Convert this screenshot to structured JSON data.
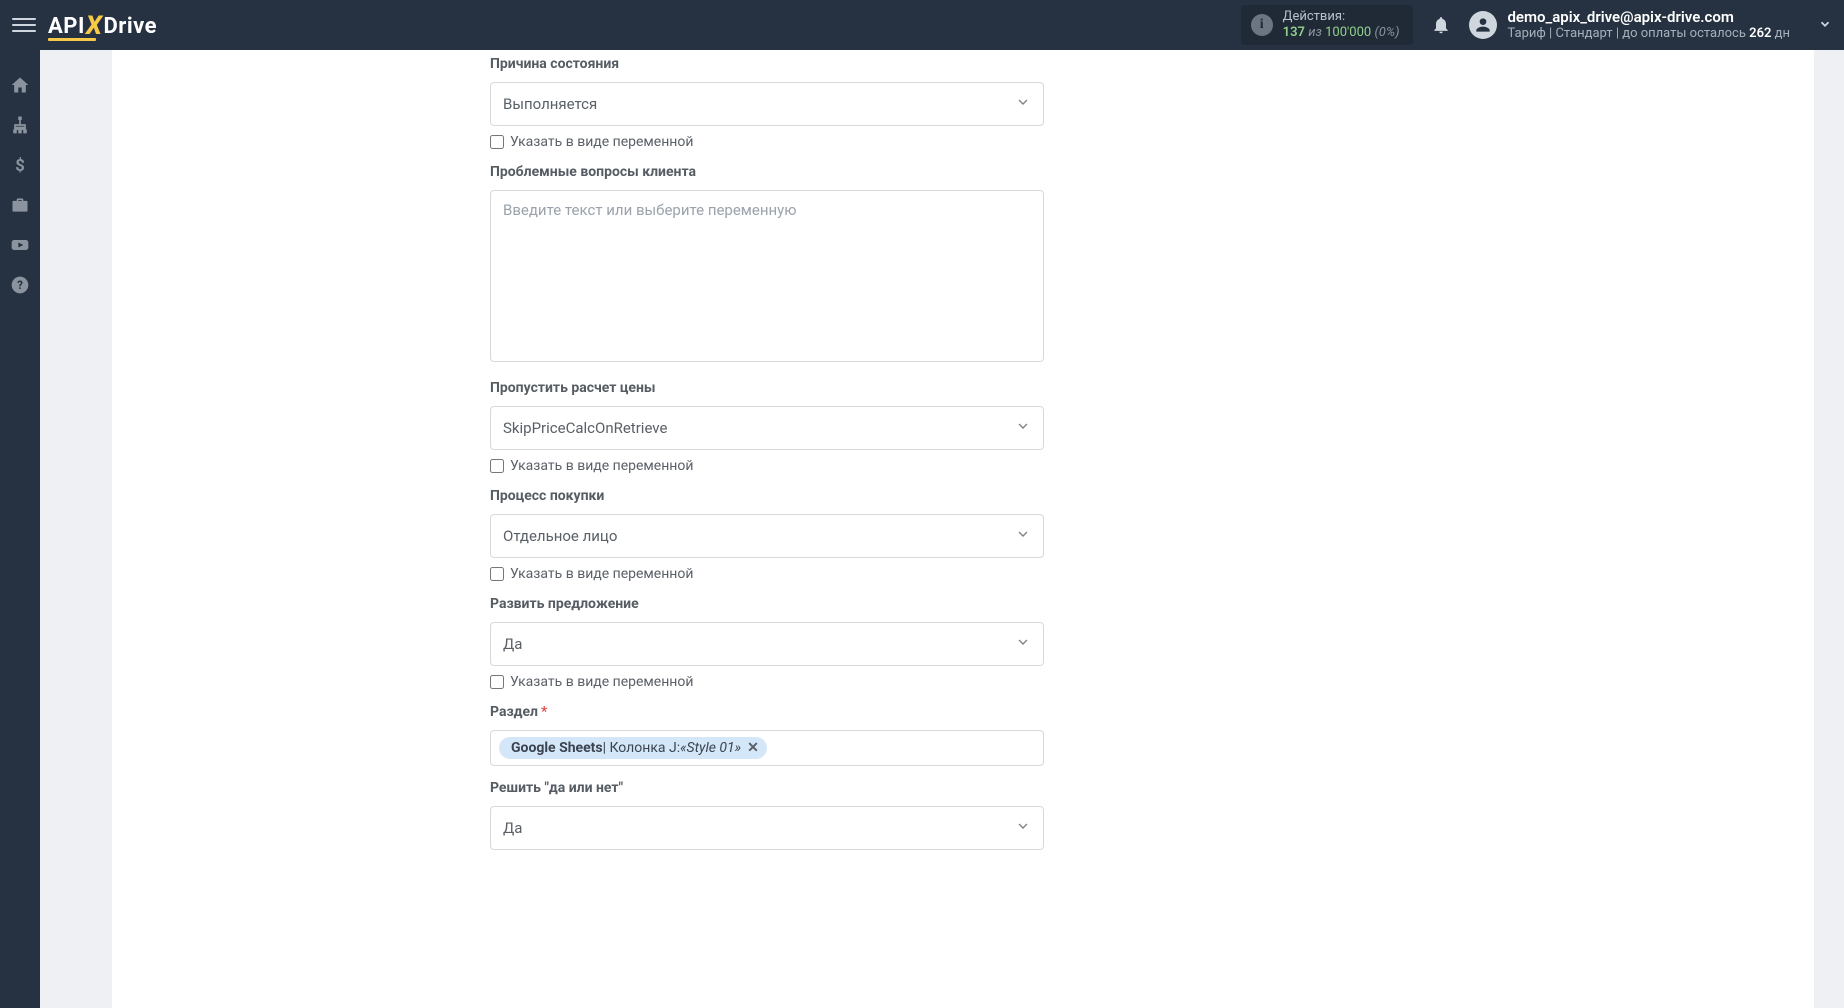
{
  "header": {
    "logo": {
      "part1": "API",
      "part2": "X",
      "part3": "Drive"
    },
    "actions": {
      "label": "Действия:",
      "count": "137",
      "of": "из",
      "total": "100'000",
      "pct": "(0%)"
    },
    "user": {
      "email": "demo_apix_drive@apix-drive.com",
      "plan_prefix": "Тариф | Стандарт | до оплаты осталось ",
      "days": "262",
      "days_suffix": " дн"
    }
  },
  "sidebar": {
    "items": [
      {
        "name": "home-icon"
      },
      {
        "name": "sitemap-icon"
      },
      {
        "name": "dollar-icon"
      },
      {
        "name": "briefcase-icon"
      },
      {
        "name": "youtube-icon"
      },
      {
        "name": "help-icon"
      }
    ]
  },
  "form": {
    "f1": {
      "label": "Причина состояния",
      "value": "Выполняется",
      "checkbox": "Указать в виде переменной"
    },
    "f2": {
      "label": "Проблемные вопросы клиента",
      "placeholder": "Введите текст или выберите переменную"
    },
    "f3": {
      "label": "Пропустить расчет цены",
      "value": "SkipPriceCalcOnRetrieve",
      "checkbox": "Указать в виде переменной"
    },
    "f4": {
      "label": "Процесс покупки",
      "value": "Отдельное лицо",
      "checkbox": "Указать в виде переменной"
    },
    "f5": {
      "label": "Развить предложение",
      "value": "Да",
      "checkbox": "Указать в виде переменной"
    },
    "f6": {
      "label": "Раздел",
      "tag_bold": "Google Sheets",
      "tag_sep": " | Колонка J: ",
      "tag_ital": "«Style 01»",
      "tag_remove": "✕"
    },
    "f7": {
      "label": "Решить \"да или нет\"",
      "value": "Да"
    }
  }
}
